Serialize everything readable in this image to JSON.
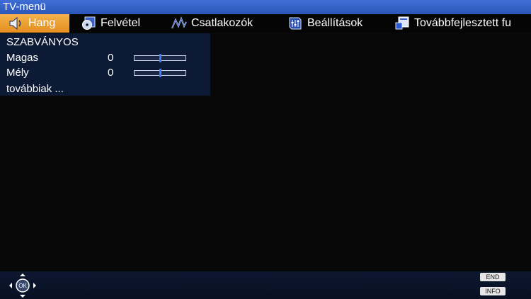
{
  "window": {
    "title": "TV-menü"
  },
  "tabs": [
    {
      "label": "Hang",
      "icon": "speaker-icon",
      "active": true
    },
    {
      "label": "Felvétel",
      "icon": "disc-icon",
      "active": false
    },
    {
      "label": "Csatlakozók",
      "icon": "connection-icon",
      "active": false
    },
    {
      "label": "Beállítások",
      "icon": "settings-icon",
      "active": false
    },
    {
      "label": "Továbbfejlesztett fu",
      "icon": "advanced-icon",
      "active": false
    }
  ],
  "sound": {
    "preset": "SZABVÁNYOS",
    "treble": {
      "label": "Magas",
      "value": "0",
      "level": 0.5
    },
    "bass": {
      "label": "Mély",
      "value": "0",
      "level": 0.5
    },
    "more": "továbbiak ..."
  },
  "footer": {
    "ok_label": "OK",
    "end_label": "END",
    "info_label": "INFO"
  },
  "colors": {
    "title_bar": "#2c56b8",
    "active_tab": "#e48f1f",
    "panel": "#0d1a36",
    "slider_thumb": "#3c7cff"
  }
}
